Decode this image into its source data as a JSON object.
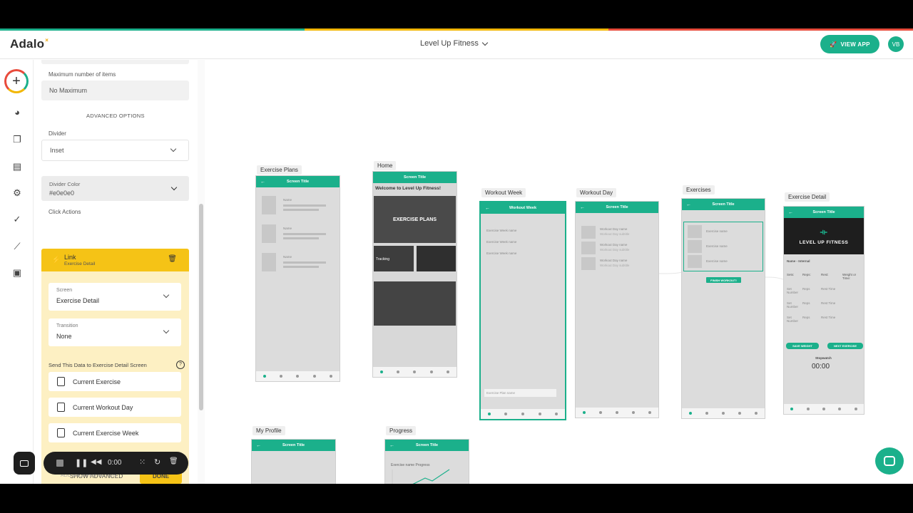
{
  "app": {
    "logo": "Adalo",
    "name": "Level Up Fitness",
    "view_app": "VIEW APP",
    "avatar": "VB"
  },
  "colors": {
    "accent": "#1bb08b",
    "warning": "#f5c316",
    "rainbow": [
      "#1bb08b",
      "#f2b705",
      "#e84b3c"
    ]
  },
  "sidenav": {
    "icons": [
      "add-icon",
      "palette-icon",
      "screens-icon",
      "database-icon",
      "settings-icon",
      "publish-icon",
      "analytics-icon",
      "versions-icon"
    ]
  },
  "panel": {
    "max_items_label": "Maximum number of items",
    "max_items_value": "No Maximum",
    "advanced_options": "ADVANCED OPTIONS",
    "divider_label": "Divider",
    "divider_value": "Inset",
    "divider_color_label": "Divider Color",
    "divider_color_value": "#e0e0e0",
    "click_actions": "Click Actions",
    "action_title": "Link",
    "action_sub": "Exercise Detail",
    "screen_label": "Screen",
    "screen_value": "Exercise Detail",
    "transition_label": "Transition",
    "transition_value": "None",
    "send_data_label": "Send This Data to Exercise Detail Screen",
    "data_items": [
      "Current Exercise",
      "Current Workout Day",
      "Current Exercise Week"
    ],
    "show_advanced": "SHOW ADVANCED",
    "done": "DONE",
    "add_another": "ADD ANOTHER ACTION"
  },
  "recorder": {
    "time": "0:00"
  },
  "screens": {
    "exercise_plans": {
      "label": "Exercise Plans",
      "title": "Screen Title",
      "rows": [
        "Name",
        "Name",
        "Name"
      ]
    },
    "home": {
      "label": "Home",
      "title": "Screen Title",
      "welcome": "Welcome to Level Up Fitness!",
      "banner": "EXERCISE PLANS",
      "tracking": "Tracking"
    },
    "workout_week": {
      "label": "Workout Week",
      "title": "Workout Week",
      "rows": [
        "Exercise Week name",
        "Exercise Week name",
        "Exercise Week name"
      ],
      "input": "Exercise Plan name"
    },
    "workout_day": {
      "label": "Workout Day",
      "title": "Screen Title",
      "rows": [
        "Workout Day name",
        "Workout Day name",
        "Workout Day name"
      ],
      "sub": "Workout Day subtitle"
    },
    "exercises": {
      "label": "Exercises",
      "title": "Screen Title",
      "rows": [
        "Exercise name",
        "Exercise name",
        "Exercise name"
      ],
      "button": "FINISH WORKOUT!"
    },
    "exercise_detail": {
      "label": "Exercise Detail",
      "title": "Screen Title",
      "brand": "LEVEL UP FITNESS",
      "name": "Name - Internal",
      "cols": [
        "Sets:",
        "Reps:",
        "Rest:",
        "Weight or Time:"
      ],
      "set": "Set Number",
      "reps": "Reps",
      "rest": "Rest Time",
      "save": "SAVE WEIGHT",
      "next": "NEXT EXERCISE",
      "stopwatch": "Stopwatch",
      "timer": "00:00"
    },
    "my_profile": {
      "label": "My Profile",
      "title": "Screen Title"
    },
    "progress": {
      "label": "Progress",
      "title": "Screen Title",
      "chart_label": "Exercise name Progress"
    }
  }
}
